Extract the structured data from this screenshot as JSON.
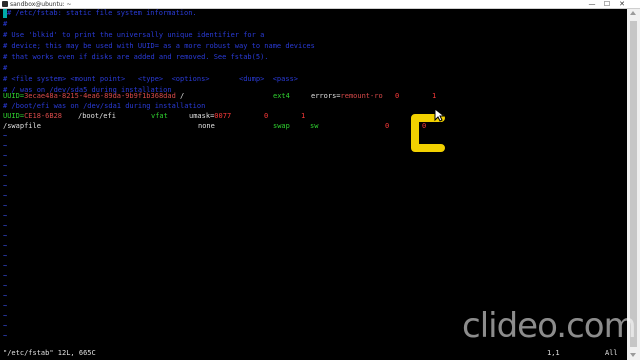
{
  "window": {
    "title": "sandbox@ubuntu: ~",
    "minimize": "—",
    "maximize": "☐",
    "close": "✕"
  },
  "editor": {
    "comment_lines": [
      "# /etc/fstab: static file system information.",
      "#",
      "# Use 'blkid' to print the universally unique identifier for a",
      "# device; this may be used with UUID= as a more robust way to name devices",
      "# that works even if disks are added and removed. See fstab(5).",
      "#",
      "# <file system> <mount point>   <type>  <options>       <dump>  <pass>",
      "# / was on /dev/sda5 during installation"
    ],
    "row1": {
      "key": "UUID=",
      "uuid": "3ecae48a-8215-4ea6-89da-9b9f1b368dad",
      "mount": " /",
      "type": "ext4",
      "opt_key": "errors=",
      "opt_val": "remount-ro",
      "dump": "0",
      "pass": "1"
    },
    "comment_efi": "# /boot/efi was on /dev/sda1 during installation",
    "row2": {
      "key": "UUID=",
      "uuid": "CE18-6B28",
      "mount": "/boot/efi",
      "type": "vfat",
      "opt_key": "umask=",
      "opt_val": "0077",
      "dump": "0",
      "pass": "1"
    },
    "row3": {
      "device": "/swapfile",
      "mount": "none",
      "type": "swap",
      "opt": "sw",
      "dump": "0",
      "pass": "0"
    },
    "tilde": "~",
    "status_file": "\"/etc/fstab\" 12L, 665C",
    "status_pos": "1,1",
    "status_all": "All"
  },
  "watermark": {
    "text": "clideo.com"
  },
  "colors": {
    "comment": "#2a3bd8",
    "uuid": "#d84a4a",
    "number": "#ff3a3a",
    "keyword": "#2fd02f",
    "annotation": "#f2d100"
  }
}
